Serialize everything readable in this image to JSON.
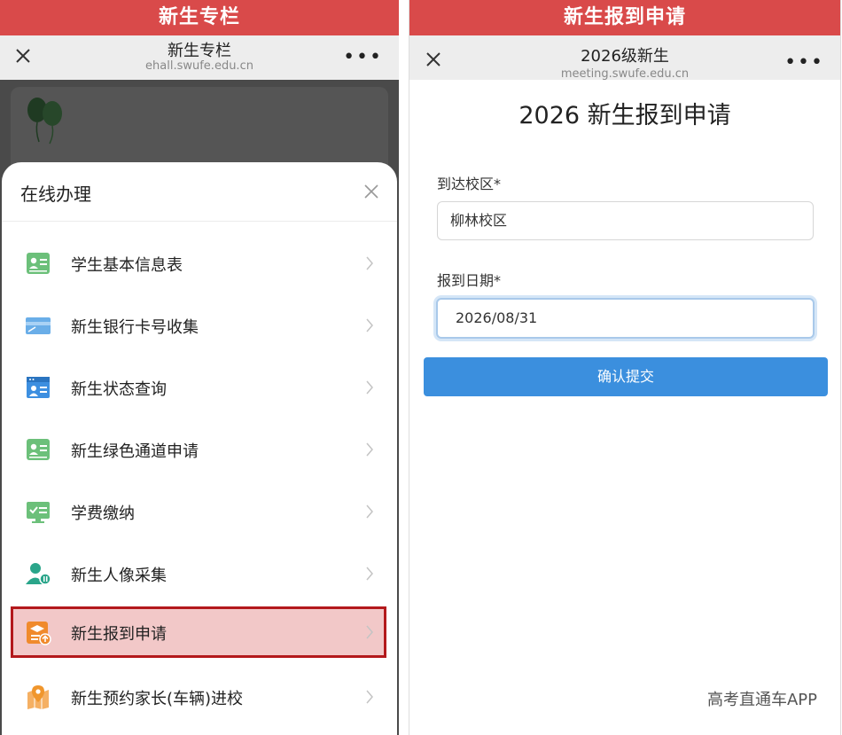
{
  "left": {
    "banner": "新生专栏",
    "navbar": {
      "title": "新生专栏",
      "url": "ehall.swufe.edu.cn"
    },
    "sheet_title": "在线办理",
    "items": [
      {
        "label": "学生基本信息表",
        "icon": "id-card-icon",
        "color": "#6cc07a"
      },
      {
        "label": "新生银行卡号收集",
        "icon": "bank-card-icon",
        "color": "#6aaee8"
      },
      {
        "label": "新生状态查询",
        "icon": "browser-window-icon",
        "color": "#3d8fe0"
      },
      {
        "label": "新生绿色通道申请",
        "icon": "id-card-icon",
        "color": "#6cc07a"
      },
      {
        "label": "学费缴纳",
        "icon": "monitor-check-icon",
        "color": "#6cc07a"
      },
      {
        "label": "新生人像采集",
        "icon": "person-portrait-icon",
        "color": "#2aa58a"
      },
      {
        "label": "新生报到申请",
        "icon": "graduation-upload-icon",
        "color": "#f08a2c"
      },
      {
        "label": "新生预约家长(车辆)进校",
        "icon": "map-pin-icon",
        "color": "#f0962c"
      }
    ]
  },
  "right": {
    "banner": "新生报到申请",
    "navbar": {
      "title": "2026级新生",
      "url": "meeting.swufe.edu.cn"
    },
    "form_title": "2026 新生报到申请",
    "campus_label": "到达校区*",
    "campus_value": "柳林校区",
    "date_label": "报到日期*",
    "date_value": "2026/08/31",
    "submit_label": "确认提交"
  },
  "watermark": "高考直通车APP",
  "colors": {
    "banner": "#d94a4a",
    "highlight_border": "#b3191c",
    "highlight_bg": "#f2c8c8",
    "submit": "#3b8fde"
  }
}
